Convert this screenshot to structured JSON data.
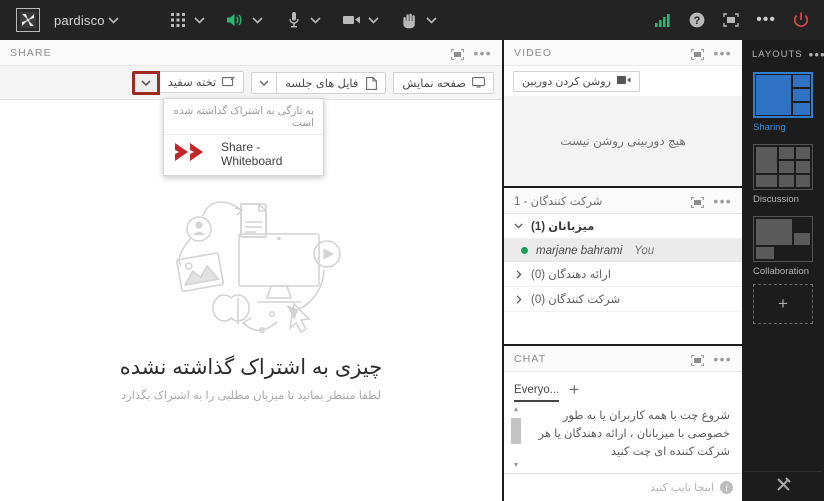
{
  "topbar": {
    "logo_icon": "adobe-connect-logo-icon",
    "room_name": "pardisco",
    "room_chevron_icon": "chevron-down-icon",
    "grid_icon": "apps-grid-icon",
    "grid_chevron_icon": "chevron-down-icon",
    "speaker_icon": "speaker-on-icon",
    "speaker_chevron_icon": "chevron-down-icon",
    "mic_icon": "microphone-icon",
    "mic_chevron_icon": "chevron-down-icon",
    "camera_icon": "video-camera-icon",
    "camera_chevron_icon": "chevron-down-icon",
    "hand_icon": "raise-hand-icon",
    "hand_chevron_icon": "chevron-down-icon",
    "signal_icon": "connection-signal-icon",
    "help_icon": "help-question-icon",
    "fullscreen_icon": "fullscreen-icon",
    "more_icon": "more-options-icon",
    "power_icon": "power-end-meeting-icon",
    "accent_green": "#2bb673",
    "accent_red": "#e8484a",
    "background": "#232323"
  },
  "share_pod": {
    "title": "SHARE",
    "maximize_icon": "pod-maximize-icon",
    "menu_icon": "pod-menu-dots-icon",
    "buttons": {
      "screen": {
        "label": "صفحه نمایش",
        "icon": "screen-share-icon"
      },
      "documents": {
        "label": "فایل های جلسه",
        "icon": "document-icon",
        "caret_icon": "chevron-down-icon"
      },
      "whiteboard": {
        "label": "تخته سفید",
        "icon": "whiteboard-icon",
        "caret_icon": "chevron-down-icon"
      }
    },
    "dropdown": {
      "header": "به تازگی به اشتراک گذاشته شده است",
      "item_label": "Share - Whiteboard",
      "item_icon": "double-chevron-red-icon"
    },
    "empty": {
      "illustration_icon": "share-empty-illustration-icon",
      "title": "چیزی به اشتراک گذاشته نشده",
      "subtitle": "لطفا منتظر بمانید تا میزبان مطلبی را به اشتراک بگذارد"
    }
  },
  "video_pod": {
    "title": "VIDEO",
    "maximize_icon": "pod-maximize-icon",
    "menu_icon": "pod-menu-dots-icon",
    "start_camera_label": "روشن کردن دوربین",
    "start_camera_icon": "video-camera-icon",
    "empty_text": "هیچ دوربینی روشن نیست"
  },
  "participants_pod": {
    "title": "شرکت کنندگان  - 1",
    "maximize_icon": "pod-maximize-icon",
    "menu_icon": "pod-menu-dots-icon",
    "groups": [
      {
        "label": "میزبانان (1)",
        "twisty_icon": "chevron-down-icon",
        "expanded": true
      },
      {
        "label": "ارائه دهندگان (0)",
        "twisty_icon": "chevron-right-icon",
        "expanded": false
      },
      {
        "label": "شرکت کنندگان (0)",
        "twisty_icon": "chevron-right-icon",
        "expanded": false
      }
    ],
    "host": {
      "name": "marjane bahrami",
      "you_label": "You",
      "status_icon": "online-dot-icon",
      "status_color": "#1aa05a"
    }
  },
  "chat_pod": {
    "title": "CHAT",
    "maximize_icon": "pod-maximize-icon",
    "menu_icon": "pod-menu-dots-icon",
    "tab_label": "Everyo...",
    "add_tab_icon": "plus-icon",
    "scroll_up_icon": "scroll-up-arrow-icon",
    "scroll_down_icon": "scroll-down-arrow-icon",
    "message": "شروع چت با همه کاربران یا به طور خصوصی با میزبانان ، ارائه دهندگان یا هر شرکت کننده ای چت کنید",
    "input_placeholder": "اینجا تایپ کنید",
    "input_info_icon": "info-circle-icon"
  },
  "layouts": {
    "title": "LAYOUTS",
    "menu_icon": "layouts-menu-dots-icon",
    "selected": "Sharing",
    "items": [
      {
        "name": "Sharing",
        "selected": true
      },
      {
        "name": "Discussion",
        "selected": false
      },
      {
        "name": "Collaboration",
        "selected": false
      }
    ],
    "add_icon": "plus-icon",
    "add_label": "+",
    "tools_icon": "tools-hammer-icon",
    "selected_color": "#3d8fdd"
  }
}
